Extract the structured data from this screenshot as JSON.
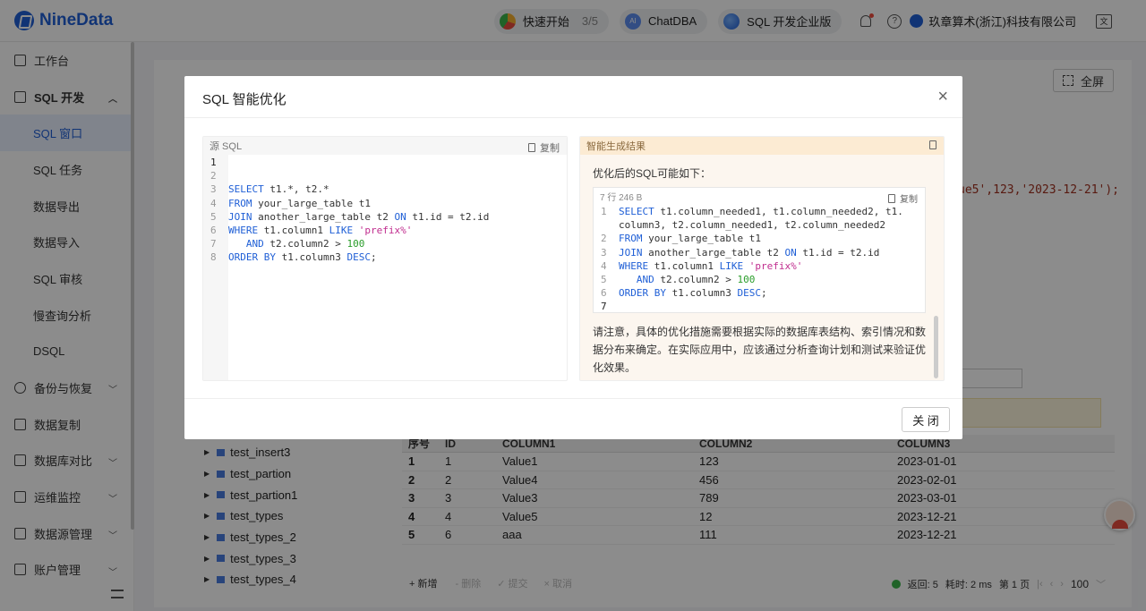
{
  "app": {
    "logo_text": "NineData"
  },
  "topbar": {
    "quickstart_label": "快速开始",
    "quickstart_progress": "3/5",
    "chatdba_label": "ChatDBA",
    "edition_label": "SQL 开发企业版",
    "company": "玖章算术(浙江)科技有限公司",
    "help_glyph": "?",
    "lang_glyph": "文"
  },
  "sidebar": {
    "items": [
      {
        "label": "工作台",
        "icon": "home-icon"
      },
      {
        "label": "SQL 开发",
        "icon": "monitor-icon",
        "expanded": true
      },
      {
        "label": "SQL 窗口",
        "active": true
      },
      {
        "label": "SQL 任务"
      },
      {
        "label": "数据导出"
      },
      {
        "label": "数据导入"
      },
      {
        "label": "SQL 审核"
      },
      {
        "label": "慢查询分析"
      },
      {
        "label": "DSQL"
      },
      {
        "label": "备份与恢复",
        "icon": "cloud-icon"
      },
      {
        "label": "数据复制",
        "icon": "copy-icon"
      },
      {
        "label": "数据库对比",
        "icon": "compare-icon"
      },
      {
        "label": "运维监控",
        "icon": "monitor-alarm-icon"
      },
      {
        "label": "数据源管理",
        "icon": "database-icon"
      },
      {
        "label": "账户管理",
        "icon": "account-icon"
      }
    ]
  },
  "background": {
    "fullscreen_label": "全屏",
    "code_fragment": "ue5',123,'2023-12-21');",
    "tree": [
      "test_insert3",
      "test_partion",
      "test_partion1",
      "test_types",
      "test_types_2",
      "test_types_3",
      "test_types_4"
    ],
    "grid": {
      "headers": [
        "序号",
        "ID",
        "COLUMN1",
        "COLUMN2",
        "COLUMN3"
      ],
      "rows": [
        [
          "1",
          "1",
          "Value1",
          "123",
          "2023-01-01"
        ],
        [
          "2",
          "2",
          "Value4",
          "456",
          "2023-02-01"
        ],
        [
          "3",
          "3",
          "Value3",
          "789",
          "2023-03-01"
        ],
        [
          "4",
          "4",
          "Value5",
          "12",
          "2023-12-21"
        ],
        [
          "5",
          "6",
          "aaa",
          "111",
          "2023-12-21"
        ]
      ]
    },
    "footer": {
      "add": "新增",
      "delete": "删除",
      "submit": "提交",
      "cancel": "取消",
      "returned": "返回: 5",
      "elapsed": "耗时: 2 ms",
      "page": "第 1 页",
      "page_size": "100"
    }
  },
  "modal": {
    "title": "SQL 智能优化",
    "close_glyph": "×",
    "source_label": "源 SQL",
    "copy_label": "复制",
    "source_code": [
      {
        "n": "1",
        "html": ""
      },
      {
        "n": "2",
        "html": ""
      },
      {
        "n": "3",
        "html": "<span class=\"kw\">SELECT</span> t1.*, t2.*"
      },
      {
        "n": "4",
        "html": "<span class=\"kw\">FROM</span> your_large_table t1"
      },
      {
        "n": "5",
        "html": "<span class=\"kw\">JOIN</span> another_large_table t2 <span class=\"kw\">ON</span> t1.id = t2.id"
      },
      {
        "n": "6",
        "html": "<span class=\"kw\">WHERE</span> t1.column1 <span class=\"kw\">LIKE</span> <span class=\"st\">'prefix%'</span>"
      },
      {
        "n": "7",
        "html": "   <span class=\"kw\">AND</span> t2.column2 &gt; <span class=\"nm\">100</span>"
      },
      {
        "n": "8",
        "html": "<span class=\"kw\">ORDER BY</span> t1.column3 <span class=\"kw\">DESC</span>;"
      }
    ],
    "result_label": "智能生成结果",
    "result_intro": "优化后的SQL可能如下：",
    "result_meta": "7 行   246 B",
    "result_code": [
      {
        "n": "1",
        "html": "<span class=\"kw\">SELECT</span> t1.column_needed1, t1.column_needed2, t1."
      },
      {
        "n": "",
        "html": "column3, t2.column_needed1, t2.column_needed2"
      },
      {
        "n": "2",
        "html": "<span class=\"kw\">FROM</span> your_large_table t1"
      },
      {
        "n": "3",
        "html": "<span class=\"kw\">JOIN</span> another_large_table t2 <span class=\"kw\">ON</span> t1.id = t2.id"
      },
      {
        "n": "4",
        "html": "<span class=\"kw\">WHERE</span> t1.column1 <span class=\"kw\">LIKE</span> <span class=\"st\">'prefix%'</span>"
      },
      {
        "n": "5",
        "html": "   <span class=\"kw\">AND</span> t2.column2 &gt; <span class=\"nm\">100</span>"
      },
      {
        "n": "6",
        "html": "<span class=\"kw\">ORDER BY</span> t1.column3 <span class=\"kw\">DESC</span>;"
      },
      {
        "n": "7",
        "html": ""
      }
    ],
    "result_note": "请注意，具体的优化措施需要根据实际的数据库表结构、索引情况和数据分布来确定。在实际应用中，应该通过分析查询计划和测试来验证优化效果。",
    "close_button": "关 闭"
  }
}
